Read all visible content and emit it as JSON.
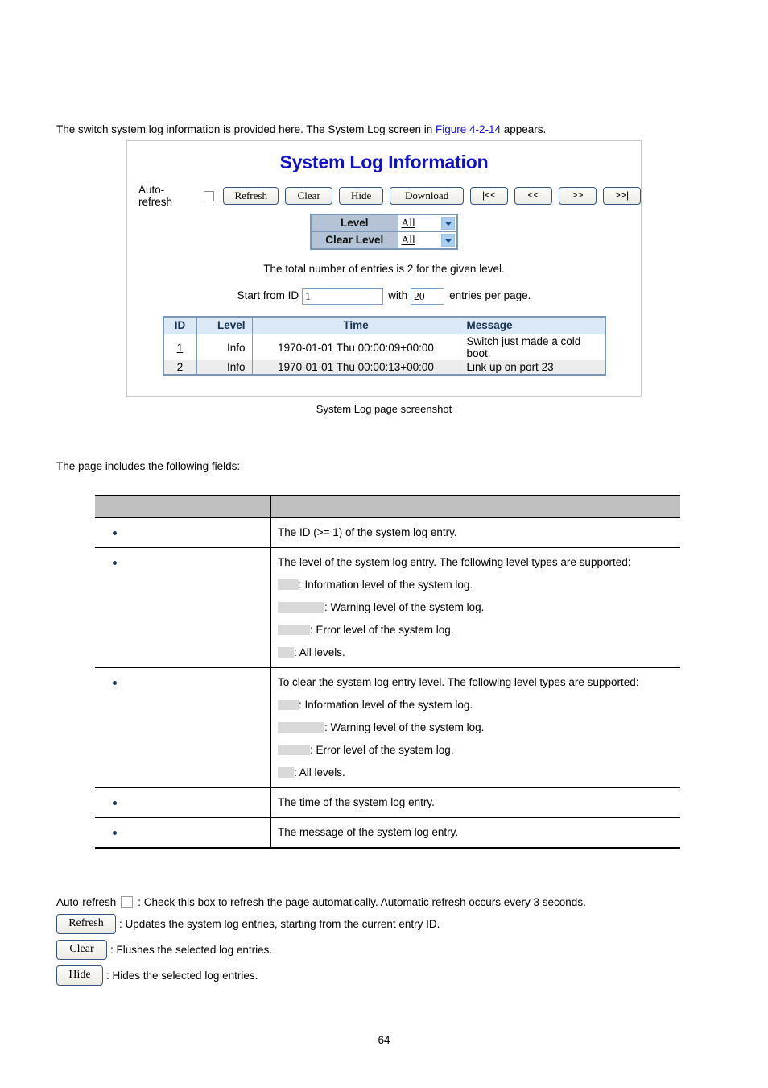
{
  "intro": {
    "before": "The switch system log information is provided here. The System Log screen in ",
    "link": "Figure 4-2-14",
    "after": " appears."
  },
  "panel": {
    "title": "System Log Information",
    "auto_refresh_label": "Auto-refresh",
    "buttons": [
      {
        "name": "refresh",
        "label": "Refresh"
      },
      {
        "name": "clear",
        "label": "Clear"
      },
      {
        "name": "hide",
        "label": "Hide"
      },
      {
        "name": "download",
        "label": "Download"
      }
    ],
    "pagination": [
      {
        "name": "first",
        "label": "|<<"
      },
      {
        "name": "prev",
        "label": "<<"
      },
      {
        "name": "next",
        "label": ">>"
      },
      {
        "name": "last",
        "label": ">>|"
      }
    ],
    "level_selector": {
      "level_label": "Level",
      "level_value": "All",
      "clear_level_label": "Clear Level",
      "clear_level_value": "All"
    },
    "total_text": "The total number of entries is 2 for the given level.",
    "start_from": {
      "prefix": "Start from ID",
      "id_value": "1",
      "middle": "with",
      "per_page_value": "20",
      "suffix": "entries per page."
    },
    "log_table": {
      "headers": [
        "ID",
        "Level",
        "Time",
        "Message"
      ],
      "rows": [
        {
          "id": "1",
          "level": "Info",
          "time": "1970-01-01 Thu 00:00:09+00:00",
          "message": "Switch just made a cold boot."
        },
        {
          "id": "2",
          "level": "Info",
          "time": "1970-01-01 Thu 00:00:13+00:00",
          "message": "Link up on port 23"
        }
      ]
    }
  },
  "caption": "System Log page screenshot",
  "includes_text": "The page includes the following fields:",
  "fields_table": {
    "headers": [
      "",
      ""
    ],
    "rows": [
      {
        "label": "",
        "desc": "The ID (>= 1) of the system log entry.",
        "sub": []
      },
      {
        "label": "",
        "desc": "The level of the system log entry. The following level types are supported:",
        "sub": [
          {
            "swatch": "sw-info",
            "text": ": Information level of the system log."
          },
          {
            "swatch": "sw-warn",
            "text": ": Warning level of the system log."
          },
          {
            "swatch": "sw-err",
            "text": ": Error level of the system log."
          },
          {
            "swatch": "sw-all",
            "text": ": All levels."
          }
        ]
      },
      {
        "label": "",
        "desc": "To clear the system log entry level. The following level types are supported:",
        "sub": [
          {
            "swatch": "sw-info",
            "text": ": Information level of the system log."
          },
          {
            "swatch": "sw-warn",
            "text": ": Warning level of the system log."
          },
          {
            "swatch": "sw-err",
            "text": ": Error level of the system log."
          },
          {
            "swatch": "sw-all",
            "text": ": All levels."
          }
        ]
      },
      {
        "label": "",
        "desc": "The time of the system log entry.",
        "sub": []
      },
      {
        "label": "",
        "desc": "The message of the system log entry.",
        "sub": []
      }
    ]
  },
  "notes": {
    "auto_refresh_label": "Auto-refresh",
    "auto_refresh_desc": ": Check this box to refresh the page automatically. Automatic refresh occurs every 3 seconds.",
    "refresh_label": "Refresh",
    "refresh_desc": ": Updates the system log entries, starting from the current entry ID.",
    "clear_label": "Clear",
    "clear_desc": ": Flushes the selected log entries.",
    "hide_label": "Hide",
    "hide_desc": ": Hides the selected log entries."
  },
  "page_number": "64",
  "colors": {
    "link": "#1414d2",
    "title": "#1010c8",
    "table_header_bg": "#c0c0c0",
    "log_header_bg": "#dbe8f5",
    "level_label_bg": "#b4c4d6",
    "swatch": "#d9d9d9"
  }
}
